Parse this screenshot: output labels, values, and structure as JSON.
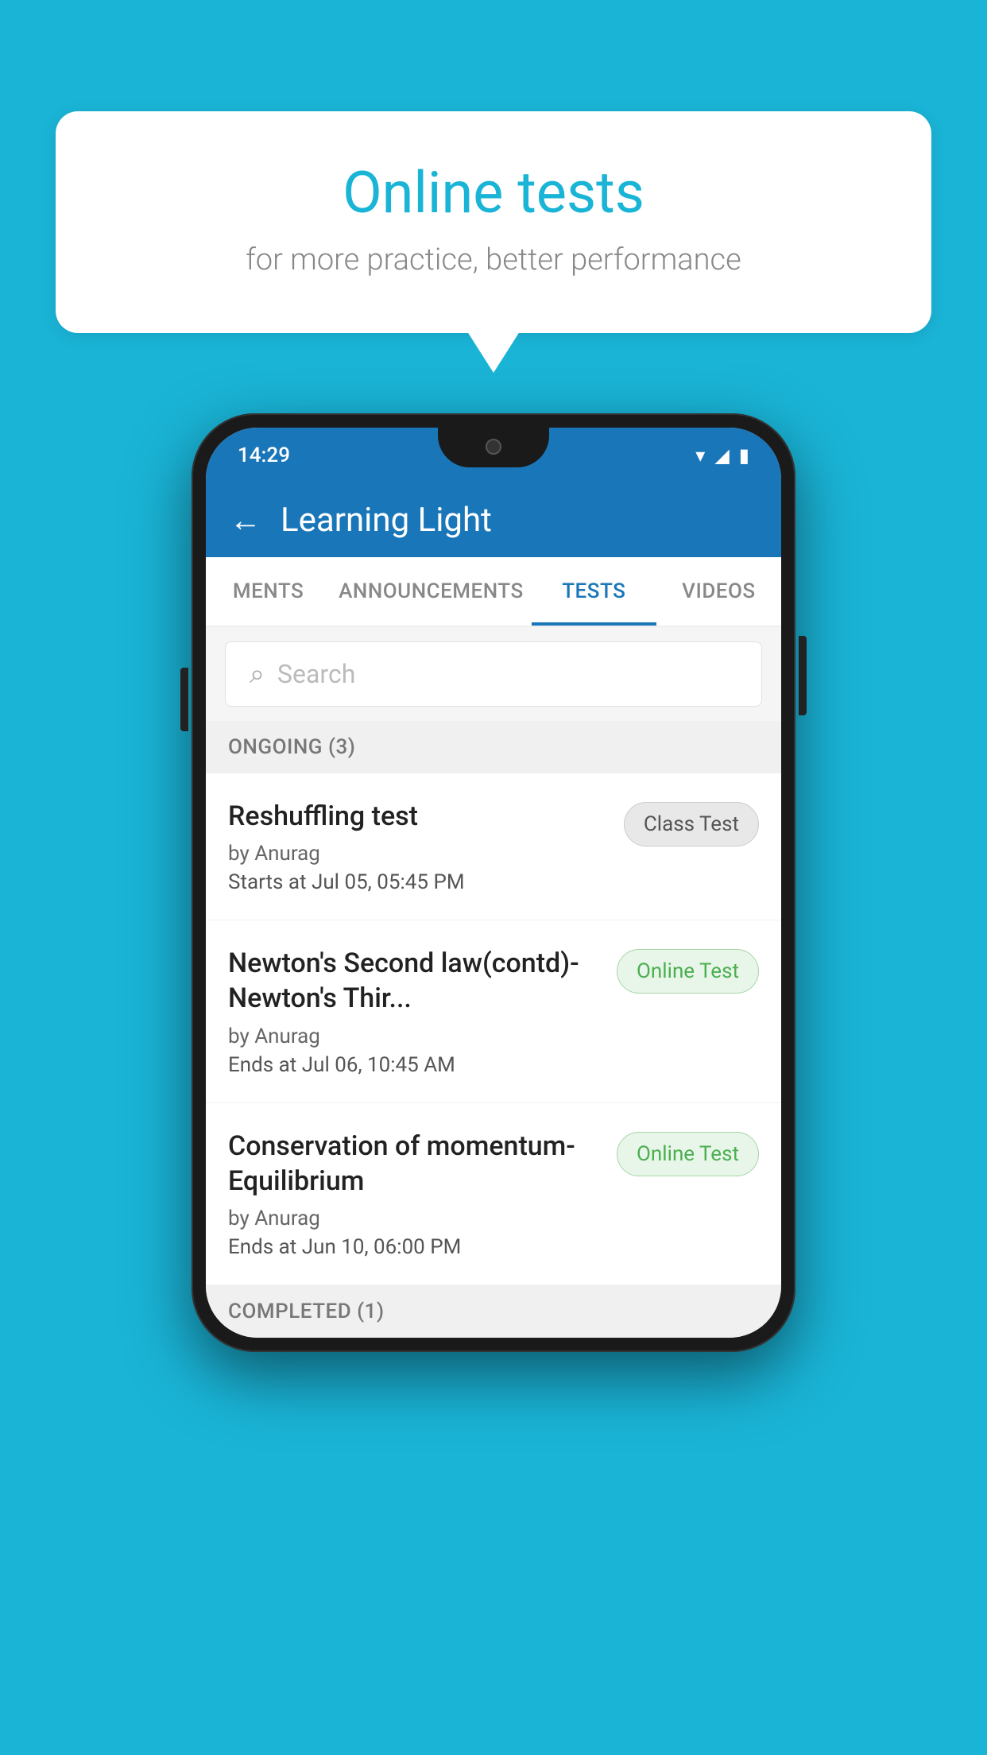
{
  "background_color": "#1ab4d7",
  "speech_bubble": {
    "title": "Online tests",
    "subtitle": "for more practice, better performance"
  },
  "phone": {
    "status_bar": {
      "time": "14:29",
      "wifi": "▾",
      "signal": "▲",
      "battery": "▮"
    },
    "app_header": {
      "back_label": "←",
      "title": "Learning Light"
    },
    "tabs": [
      {
        "label": "MENTS",
        "active": false
      },
      {
        "label": "ANNOUNCEMENTS",
        "active": false
      },
      {
        "label": "TESTS",
        "active": true
      },
      {
        "label": "VIDEOS",
        "active": false
      }
    ],
    "search": {
      "placeholder": "Search"
    },
    "sections": [
      {
        "title": "ONGOING (3)",
        "tests": [
          {
            "name": "Reshuffling test",
            "author": "by Anurag",
            "date": "Starts at  Jul 05, 05:45 PM",
            "badge": "Class Test",
            "badge_type": "class"
          },
          {
            "name": "Newton's Second law(contd)-Newton's Thir...",
            "author": "by Anurag",
            "date": "Ends at  Jul 06, 10:45 AM",
            "badge": "Online Test",
            "badge_type": "online"
          },
          {
            "name": "Conservation of momentum-Equilibrium",
            "author": "by Anurag",
            "date": "Ends at  Jun 10, 06:00 PM",
            "badge": "Online Test",
            "badge_type": "online"
          }
        ]
      }
    ],
    "completed_section_title": "COMPLETED (1)"
  }
}
